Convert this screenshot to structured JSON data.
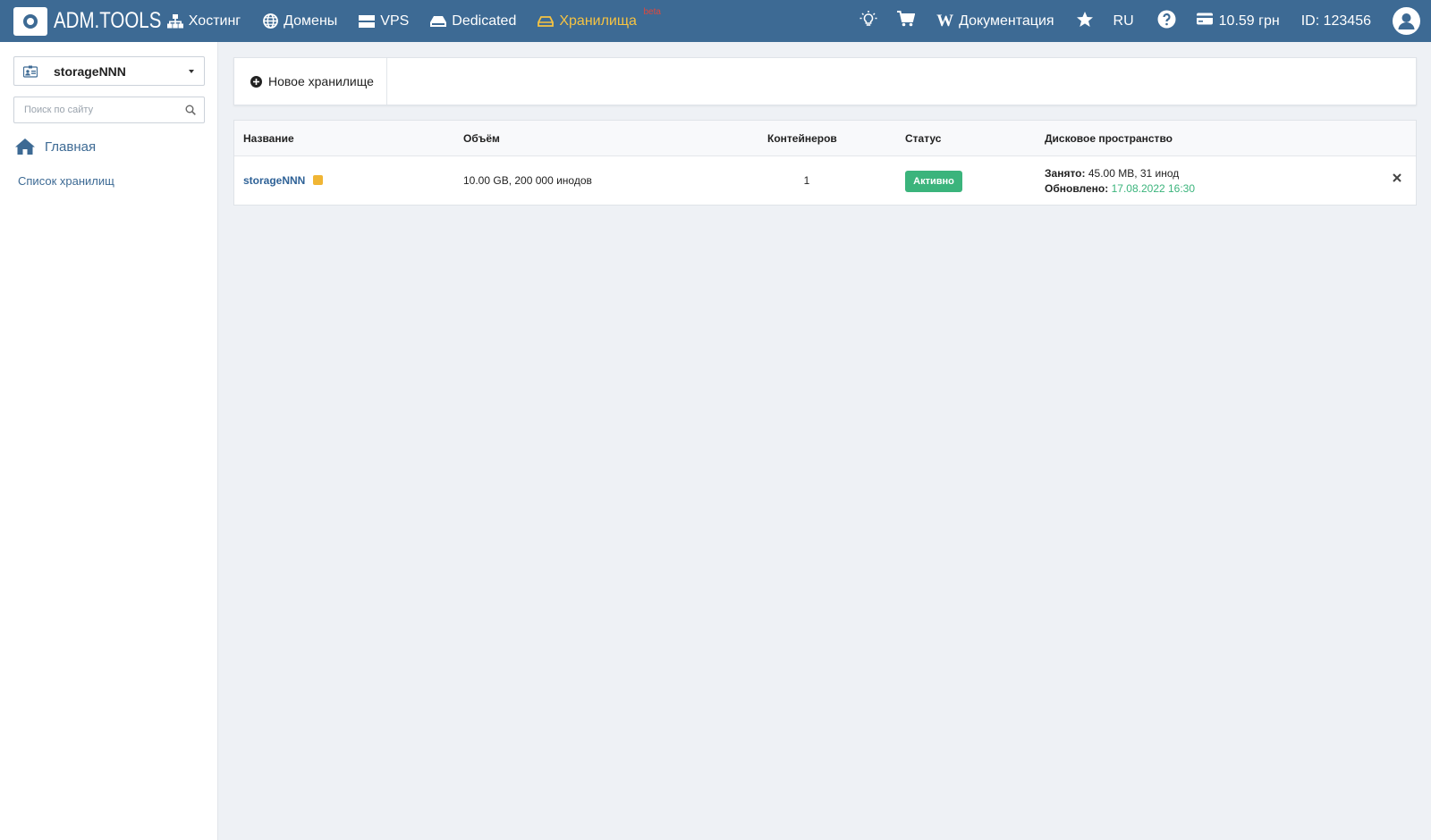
{
  "header": {
    "logo_text": "ADM.TOOLS",
    "nav": [
      {
        "label": "Хостинг",
        "icon": "sitemap-icon"
      },
      {
        "label": "Домены",
        "icon": "globe-icon"
      },
      {
        "label": "VPS",
        "icon": "server-icon"
      },
      {
        "label": "Dedicated",
        "icon": "hdd-icon"
      },
      {
        "label": "Хранилища",
        "icon": "storage-icon",
        "active": true,
        "badge": "beta"
      }
    ],
    "tools": {
      "bulb_icon": "lightbulb-icon",
      "cart_icon": "cart-icon",
      "docs_label": "Документация",
      "docs_icon": "wikipedia-icon",
      "favorites_icon": "star-icon",
      "language": "RU",
      "help_icon": "question-icon",
      "balance": "10.59 грн",
      "balance_icon": "credit-card-icon",
      "user_id": "ID: 123456",
      "avatar_icon": "user-icon"
    },
    "colors": {
      "bar": "#3d6a94",
      "active": "#f6c342",
      "beta": "#e0483d"
    }
  },
  "sidebar": {
    "account": "storageNNN",
    "search_placeholder": "Поиск по сайту",
    "home_label": "Главная",
    "links": [
      "Список хранилищ"
    ]
  },
  "toolbar": {
    "new_storage_label": "Новое хранилище"
  },
  "table": {
    "columns": [
      "Название",
      "Объём",
      "Контейнеров",
      "Статус",
      "Дисковое пространство"
    ],
    "rows": [
      {
        "name": "storageNNN",
        "volume": "10.00 GB, 200 000 инодов",
        "containers": "1",
        "status": "Активно",
        "used_label": "Занято:",
        "used_value": "45.00 MB, 31 инод",
        "updated_label": "Обновлено:",
        "updated_value": "17.08.2022 16:30"
      }
    ],
    "colors": {
      "status": "#3bb47c",
      "link": "#2f6297"
    }
  }
}
